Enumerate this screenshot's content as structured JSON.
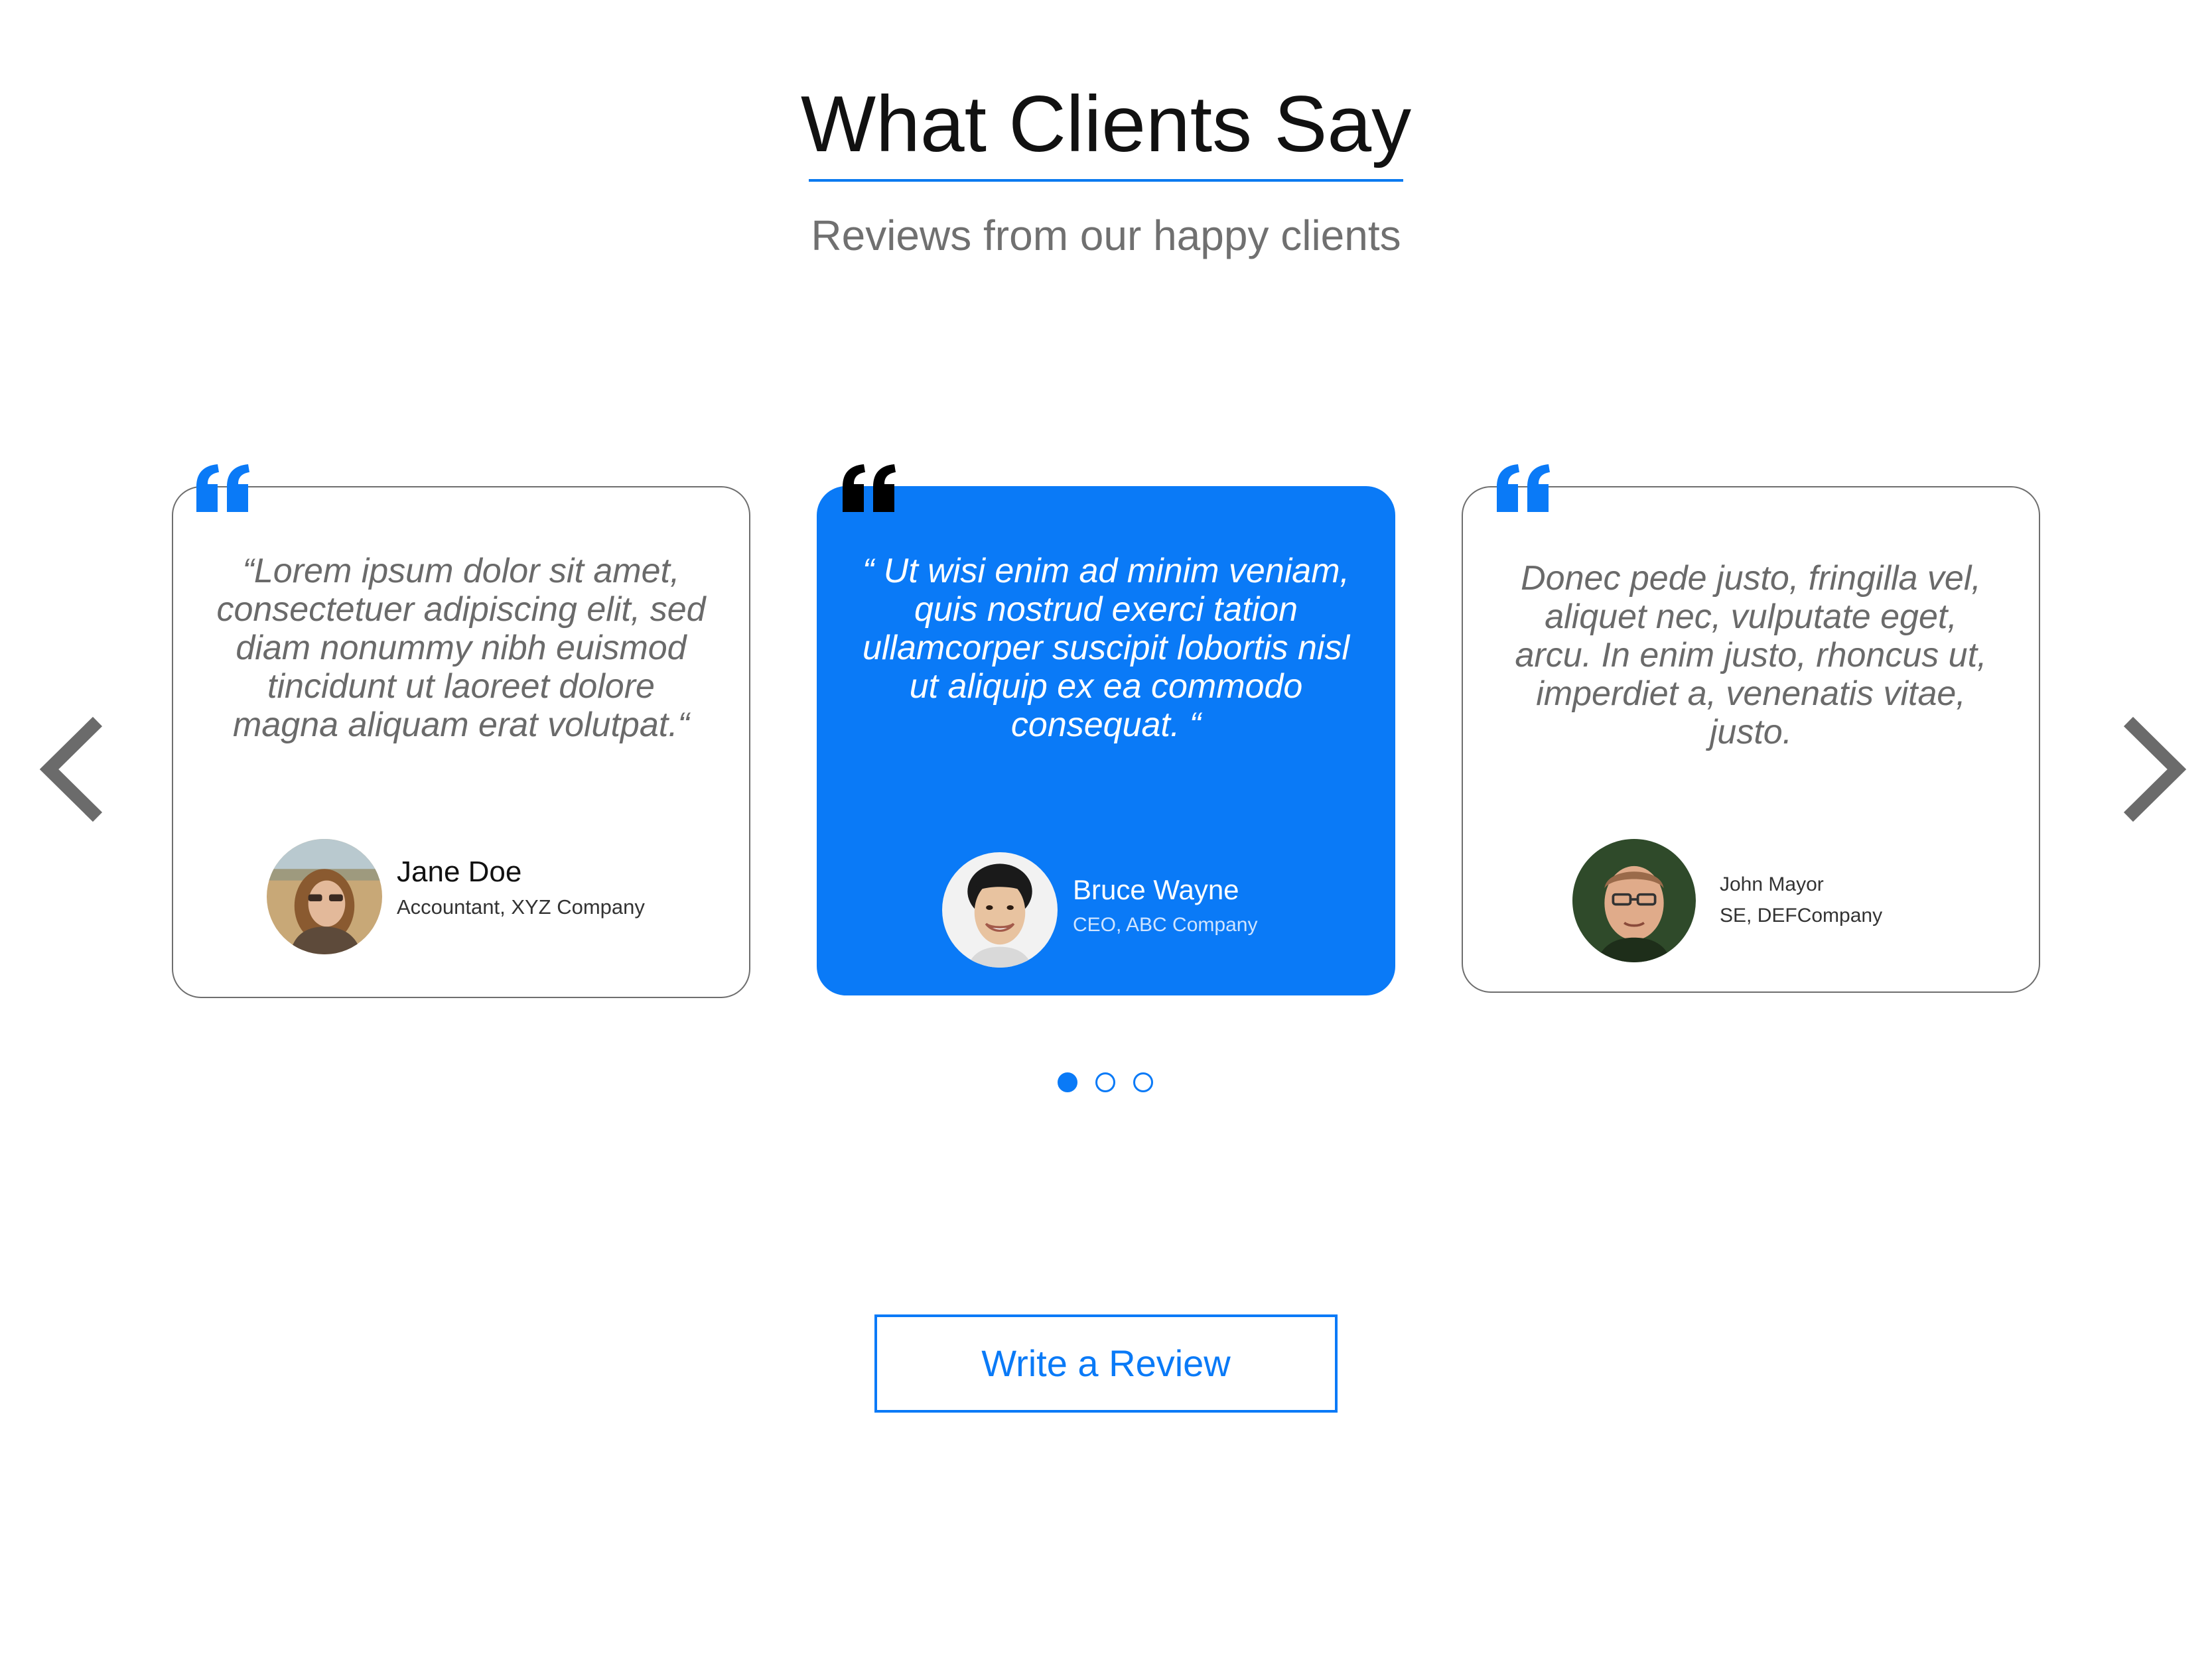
{
  "header": {
    "title": "What Clients Say",
    "subtitle": "Reviews from our happy clients"
  },
  "colors": {
    "accent": "#0a7af7",
    "outline": "#6e6e6e",
    "muted_text": "#6a6a6a"
  },
  "carousel": {
    "prev_icon": "chevron-left-icon",
    "next_icon": "chevron-right-icon",
    "active_index": 0,
    "total_slides": 3,
    "testimonials": [
      {
        "quote": "“Lorem ipsum dolor sit amet, consectetuer adipiscing elit, sed diam nonummy nibh euismod tincidunt ut laoreet dolore magna aliquam erat volutpat.“",
        "name": "Jane Doe",
        "role": "Accountant, XYZ Company",
        "highlighted": false,
        "quote_icon_color": "#0a7af7"
      },
      {
        "quote": "“ Ut wisi enim ad minim veniam, quis nostrud exerci tation ullamcorper suscipit lobortis nisl ut aliquip ex ea commodo consequat. “",
        "name": "Bruce Wayne",
        "role": "CEO, ABC Company",
        "highlighted": true,
        "quote_icon_color": "#000000"
      },
      {
        "quote": "Donec pede justo, fringilla vel, aliquet nec, vulputate eget, arcu. In enim justo, rhoncus ut, imperdiet a, venenatis vitae, justo.",
        "name": "John Mayor",
        "role": "SE, DEFCompany",
        "highlighted": false,
        "quote_icon_color": "#0a7af7"
      }
    ]
  },
  "actions": {
    "write_review_label": "Write a Review"
  }
}
